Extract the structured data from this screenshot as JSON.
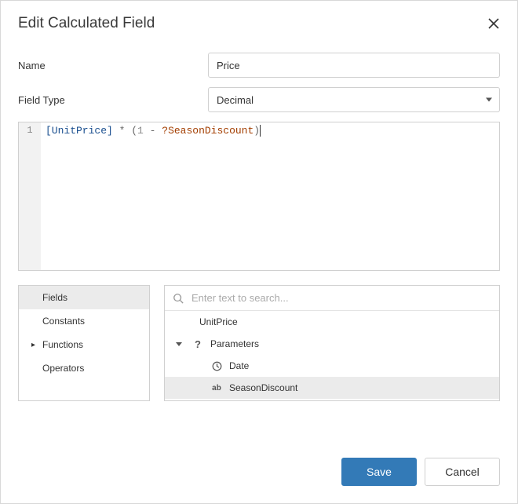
{
  "dialog": {
    "title": "Edit Calculated Field"
  },
  "form": {
    "name_label": "Name",
    "name_value": "Price",
    "type_label": "Field Type",
    "type_value": "Decimal"
  },
  "editor": {
    "line_number": "1",
    "tokens": {
      "field": "[UnitPrice]",
      "times": " * ",
      "lparen": "(",
      "num": "1",
      "minus": " - ",
      "param": "?SeasonDiscount",
      "rparen": ")"
    }
  },
  "tabs": [
    {
      "label": "Fields",
      "active": true,
      "has_sub": false
    },
    {
      "label": "Constants",
      "active": false,
      "has_sub": false
    },
    {
      "label": "Functions",
      "active": false,
      "has_sub": true
    },
    {
      "label": "Operators",
      "active": false,
      "has_sub": false
    }
  ],
  "search": {
    "placeholder": "Enter text to search..."
  },
  "tree": {
    "item_unitprice": "UnitPrice",
    "group_parameters": "Parameters",
    "item_date": "Date",
    "item_seasondiscount": "SeasonDiscount"
  },
  "footer": {
    "save": "Save",
    "cancel": "Cancel"
  }
}
